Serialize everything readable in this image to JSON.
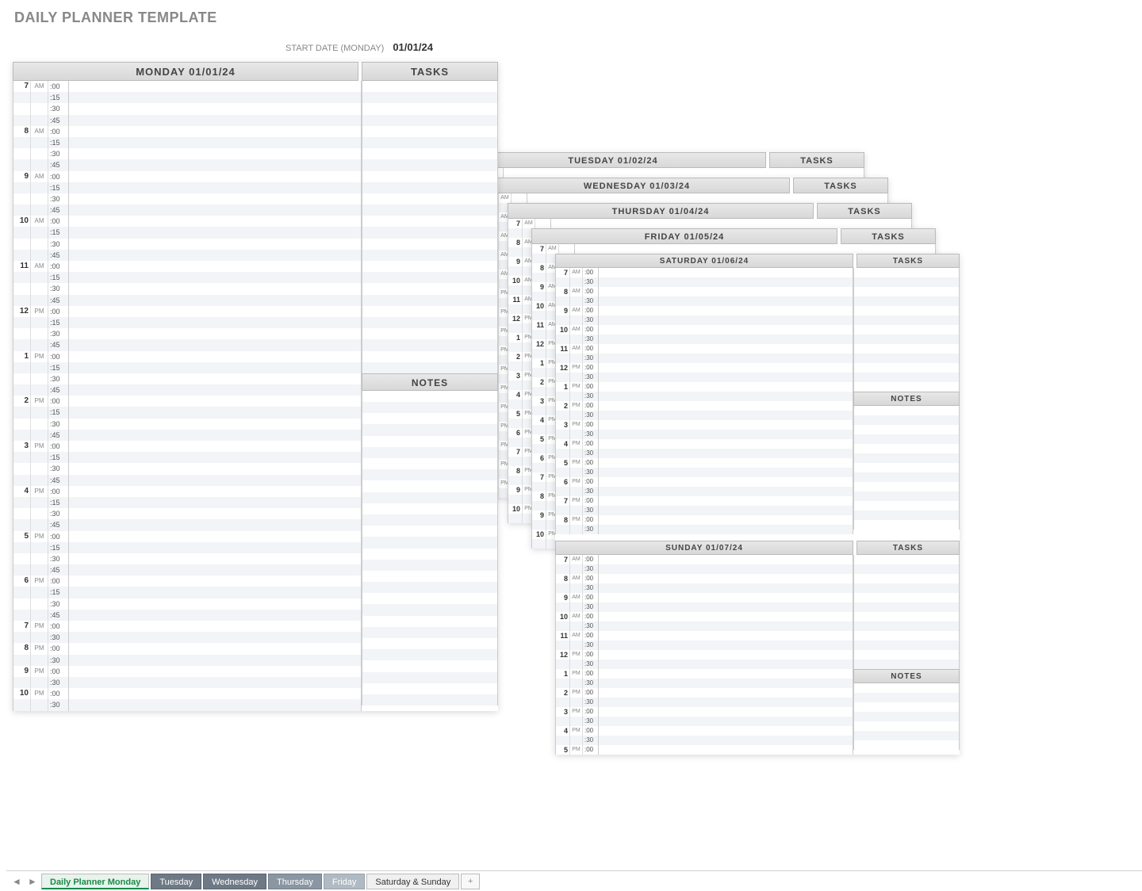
{
  "title": "DAILY PLANNER TEMPLATE",
  "start_date_label": "START DATE (MONDAY)",
  "start_date_value": "01/01/24",
  "labels": {
    "tasks": "TASKS",
    "notes": "NOTES"
  },
  "days": {
    "monday": "MONDAY 01/01/24",
    "tuesday": "TUESDAY 01/02/24",
    "wednesday": "WEDNESDAY 01/03/24",
    "thursday": "THURSDAY 01/04/24",
    "friday": "FRIDAY 01/05/24",
    "saturday": "SATURDAY 01/06/24",
    "sunday": "SUNDAY 01/07/24"
  },
  "monday_slots": [
    {
      "hour": "7",
      "ampm": "AM",
      "min": ":00"
    },
    {
      "hour": "",
      "ampm": "",
      "min": ":15"
    },
    {
      "hour": "",
      "ampm": "",
      "min": ":30"
    },
    {
      "hour": "",
      "ampm": "",
      "min": ":45"
    },
    {
      "hour": "8",
      "ampm": "AM",
      "min": ":00"
    },
    {
      "hour": "",
      "ampm": "",
      "min": ":15"
    },
    {
      "hour": "",
      "ampm": "",
      "min": ":30"
    },
    {
      "hour": "",
      "ampm": "",
      "min": ":45"
    },
    {
      "hour": "9",
      "ampm": "AM",
      "min": ":00"
    },
    {
      "hour": "",
      "ampm": "",
      "min": ":15"
    },
    {
      "hour": "",
      "ampm": "",
      "min": ":30"
    },
    {
      "hour": "",
      "ampm": "",
      "min": ":45"
    },
    {
      "hour": "10",
      "ampm": "AM",
      "min": ":00"
    },
    {
      "hour": "",
      "ampm": "",
      "min": ":15"
    },
    {
      "hour": "",
      "ampm": "",
      "min": ":30"
    },
    {
      "hour": "",
      "ampm": "",
      "min": ":45"
    },
    {
      "hour": "11",
      "ampm": "AM",
      "min": ":00"
    },
    {
      "hour": "",
      "ampm": "",
      "min": ":15"
    },
    {
      "hour": "",
      "ampm": "",
      "min": ":30"
    },
    {
      "hour": "",
      "ampm": "",
      "min": ":45"
    },
    {
      "hour": "12",
      "ampm": "PM",
      "min": ":00"
    },
    {
      "hour": "",
      "ampm": "",
      "min": ":15"
    },
    {
      "hour": "",
      "ampm": "",
      "min": ":30"
    },
    {
      "hour": "",
      "ampm": "",
      "min": ":45"
    },
    {
      "hour": "1",
      "ampm": "PM",
      "min": ":00"
    },
    {
      "hour": "",
      "ampm": "",
      "min": ":15"
    },
    {
      "hour": "",
      "ampm": "",
      "min": ":30"
    },
    {
      "hour": "",
      "ampm": "",
      "min": ":45"
    },
    {
      "hour": "2",
      "ampm": "PM",
      "min": ":00"
    },
    {
      "hour": "",
      "ampm": "",
      "min": ":15"
    },
    {
      "hour": "",
      "ampm": "",
      "min": ":30"
    },
    {
      "hour": "",
      "ampm": "",
      "min": ":45"
    },
    {
      "hour": "3",
      "ampm": "PM",
      "min": ":00"
    },
    {
      "hour": "",
      "ampm": "",
      "min": ":15"
    },
    {
      "hour": "",
      "ampm": "",
      "min": ":30"
    },
    {
      "hour": "",
      "ampm": "",
      "min": ":45"
    },
    {
      "hour": "4",
      "ampm": "PM",
      "min": ":00"
    },
    {
      "hour": "",
      "ampm": "",
      "min": ":15"
    },
    {
      "hour": "",
      "ampm": "",
      "min": ":30"
    },
    {
      "hour": "",
      "ampm": "",
      "min": ":45"
    },
    {
      "hour": "5",
      "ampm": "PM",
      "min": ":00"
    },
    {
      "hour": "",
      "ampm": "",
      "min": ":15"
    },
    {
      "hour": "",
      "ampm": "",
      "min": ":30"
    },
    {
      "hour": "",
      "ampm": "",
      "min": ":45"
    },
    {
      "hour": "6",
      "ampm": "PM",
      "min": ":00"
    },
    {
      "hour": "",
      "ampm": "",
      "min": ":15"
    },
    {
      "hour": "",
      "ampm": "",
      "min": ":30"
    },
    {
      "hour": "",
      "ampm": "",
      "min": ":45"
    },
    {
      "hour": "7",
      "ampm": "PM",
      "min": ":00"
    },
    {
      "hour": "",
      "ampm": "",
      "min": ":30"
    },
    {
      "hour": "8",
      "ampm": "PM",
      "min": ":00"
    },
    {
      "hour": "",
      "ampm": "",
      "min": ":30"
    },
    {
      "hour": "9",
      "ampm": "PM",
      "min": ":00"
    },
    {
      "hour": "",
      "ampm": "",
      "min": ":30"
    },
    {
      "hour": "10",
      "ampm": "PM",
      "min": ":00"
    },
    {
      "hour": "",
      "ampm": "",
      "min": ":30"
    }
  ],
  "weekday_slots": [
    {
      "hour": "7",
      "ampm": "AM",
      "min": ""
    },
    {
      "hour": "",
      "ampm": "",
      "min": ""
    },
    {
      "hour": "8",
      "ampm": "AM",
      "min": ""
    },
    {
      "hour": "",
      "ampm": "",
      "min": ""
    },
    {
      "hour": "9",
      "ampm": "AM",
      "min": ""
    },
    {
      "hour": "",
      "ampm": "",
      "min": ""
    },
    {
      "hour": "10",
      "ampm": "AM",
      "min": ""
    },
    {
      "hour": "",
      "ampm": "",
      "min": ""
    },
    {
      "hour": "11",
      "ampm": "AM",
      "min": ""
    },
    {
      "hour": "",
      "ampm": "",
      "min": ""
    },
    {
      "hour": "12",
      "ampm": "PM",
      "min": ""
    },
    {
      "hour": "",
      "ampm": "",
      "min": ""
    },
    {
      "hour": "1",
      "ampm": "PM",
      "min": ""
    },
    {
      "hour": "",
      "ampm": "",
      "min": ""
    },
    {
      "hour": "2",
      "ampm": "PM",
      "min": ""
    },
    {
      "hour": "",
      "ampm": "",
      "min": ""
    },
    {
      "hour": "3",
      "ampm": "PM",
      "min": ""
    },
    {
      "hour": "",
      "ampm": "",
      "min": ""
    },
    {
      "hour": "4",
      "ampm": "PM",
      "min": ""
    },
    {
      "hour": "",
      "ampm": "",
      "min": ""
    },
    {
      "hour": "5",
      "ampm": "PM",
      "min": ""
    },
    {
      "hour": "",
      "ampm": "",
      "min": ""
    },
    {
      "hour": "6",
      "ampm": "PM",
      "min": ""
    },
    {
      "hour": "",
      "ampm": "",
      "min": ""
    },
    {
      "hour": "7",
      "ampm": "PM",
      "min": ""
    },
    {
      "hour": "",
      "ampm": "",
      "min": ""
    },
    {
      "hour": "8",
      "ampm": "PM",
      "min": ""
    },
    {
      "hour": "",
      "ampm": "",
      "min": ""
    },
    {
      "hour": "9",
      "ampm": "PM",
      "min": ""
    },
    {
      "hour": "",
      "ampm": "",
      "min": ""
    },
    {
      "hour": "10",
      "ampm": "PM",
      "min": ""
    },
    {
      "hour": "",
      "ampm": "",
      "min": ""
    }
  ],
  "weekend_slots": [
    {
      "hour": "7",
      "ampm": "AM",
      "min": ":00"
    },
    {
      "hour": "",
      "ampm": "",
      "min": ":30"
    },
    {
      "hour": "8",
      "ampm": "AM",
      "min": ":00"
    },
    {
      "hour": "",
      "ampm": "",
      "min": ":30"
    },
    {
      "hour": "9",
      "ampm": "AM",
      "min": ":00"
    },
    {
      "hour": "",
      "ampm": "",
      "min": ":30"
    },
    {
      "hour": "10",
      "ampm": "AM",
      "min": ":00"
    },
    {
      "hour": "",
      "ampm": "",
      "min": ":30"
    },
    {
      "hour": "11",
      "ampm": "AM",
      "min": ":00"
    },
    {
      "hour": "",
      "ampm": "",
      "min": ":30"
    },
    {
      "hour": "12",
      "ampm": "PM",
      "min": ":00"
    },
    {
      "hour": "",
      "ampm": "",
      "min": ":30"
    },
    {
      "hour": "1",
      "ampm": "PM",
      "min": ":00"
    },
    {
      "hour": "",
      "ampm": "",
      "min": ":30"
    },
    {
      "hour": "2",
      "ampm": "PM",
      "min": ":00"
    },
    {
      "hour": "",
      "ampm": "",
      "min": ":30"
    },
    {
      "hour": "3",
      "ampm": "PM",
      "min": ":00"
    },
    {
      "hour": "",
      "ampm": "",
      "min": ":30"
    },
    {
      "hour": "4",
      "ampm": "PM",
      "min": ":00"
    },
    {
      "hour": "",
      "ampm": "",
      "min": ":30"
    },
    {
      "hour": "5",
      "ampm": "PM",
      "min": ":00"
    },
    {
      "hour": "",
      "ampm": "",
      "min": ":30"
    },
    {
      "hour": "6",
      "ampm": "PM",
      "min": ":00"
    },
    {
      "hour": "",
      "ampm": "",
      "min": ":30"
    },
    {
      "hour": "7",
      "ampm": "PM",
      "min": ":00"
    },
    {
      "hour": "",
      "ampm": "",
      "min": ":30"
    },
    {
      "hour": "8",
      "ampm": "PM",
      "min": ":00"
    },
    {
      "hour": "",
      "ampm": "",
      "min": ":30"
    }
  ],
  "sunday_visible_slots": [
    {
      "hour": "7",
      "ampm": "AM",
      "min": ":00"
    },
    {
      "hour": "",
      "ampm": "",
      "min": ":30"
    },
    {
      "hour": "8",
      "ampm": "AM",
      "min": ":00"
    },
    {
      "hour": "",
      "ampm": "",
      "min": ":30"
    },
    {
      "hour": "9",
      "ampm": "AM",
      "min": ":00"
    },
    {
      "hour": "",
      "ampm": "",
      "min": ":30"
    },
    {
      "hour": "10",
      "ampm": "AM",
      "min": ":00"
    },
    {
      "hour": "",
      "ampm": "",
      "min": ":30"
    },
    {
      "hour": "11",
      "ampm": "AM",
      "min": ":00"
    },
    {
      "hour": "",
      "ampm": "",
      "min": ":30"
    },
    {
      "hour": "12",
      "ampm": "PM",
      "min": ":00"
    },
    {
      "hour": "",
      "ampm": "",
      "min": ":30"
    },
    {
      "hour": "1",
      "ampm": "PM",
      "min": ":00"
    },
    {
      "hour": "",
      "ampm": "",
      "min": ":30"
    },
    {
      "hour": "2",
      "ampm": "PM",
      "min": ":00"
    },
    {
      "hour": "",
      "ampm": "",
      "min": ":30"
    },
    {
      "hour": "3",
      "ampm": "PM",
      "min": ":00"
    },
    {
      "hour": "",
      "ampm": "",
      "min": ":30"
    },
    {
      "hour": "4",
      "ampm": "PM",
      "min": ":00"
    },
    {
      "hour": "",
      "ampm": "",
      "min": ":30"
    },
    {
      "hour": "5",
      "ampm": "PM",
      "min": ":00"
    }
  ],
  "tabs": [
    {
      "label": "Daily Planner Monday",
      "style": "active"
    },
    {
      "label": "Tuesday",
      "style": "dark"
    },
    {
      "label": "Wednesday",
      "style": "dark"
    },
    {
      "label": "Thursday",
      "style": "mid"
    },
    {
      "label": "Friday",
      "style": "light"
    },
    {
      "label": "Saturday & Sunday",
      "style": "plain"
    }
  ]
}
